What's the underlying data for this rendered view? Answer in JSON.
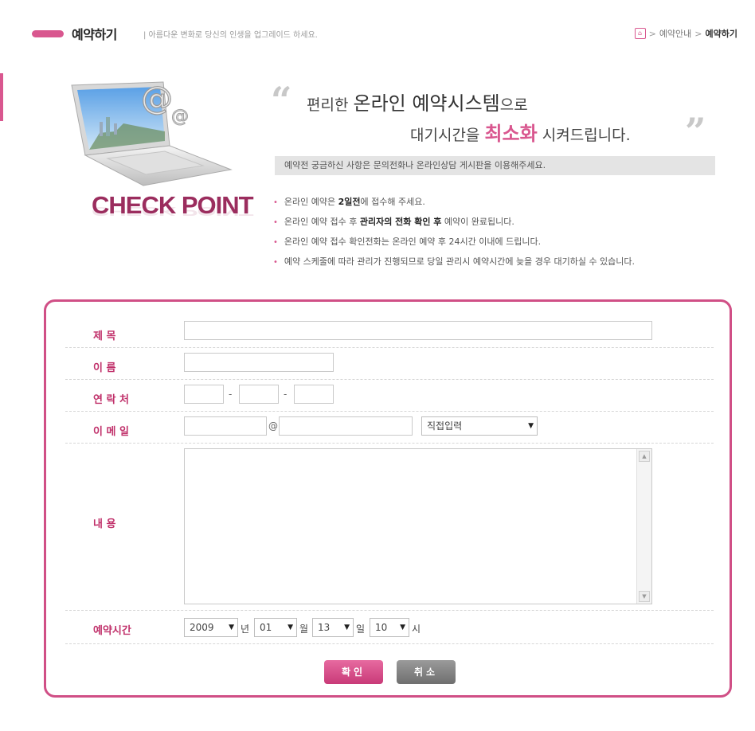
{
  "header": {
    "title": "예약하기",
    "subtitle": "| 아름다운 변화로 당신의 인생을 업그레이드 하세요.",
    "breadcrumb": {
      "home_icon": "home-icon",
      "parent": "예약안내",
      "current": "예약하기",
      "separator": ">"
    }
  },
  "intro": {
    "check_point": "CHECK POINT",
    "slogan_line1_a": "편리한 ",
    "slogan_line1_b": "온라인 예약시스템",
    "slogan_line1_c": "으로",
    "slogan_line2_a": "대기시간을 ",
    "slogan_line2_b": "최소화",
    "slogan_line2_c": " 시켜드립니다.",
    "notice": "예약전 궁금하신 사항은 문의전화나 온라인상담 게시판을 이용해주세요.",
    "bullets": [
      {
        "pre": "온라인 예약은 ",
        "bold": "2일전",
        "post": "에 접수해 주세요."
      },
      {
        "pre": "온라인 예약 접수 후 ",
        "bold": "관리자의 전화 확인 후",
        "post": " 예약이 완료됩니다."
      },
      {
        "pre": "온라인 예약 접수 확인전화는 온라인 예약 후 24시간 이내에 드립니다.",
        "bold": "",
        "post": ""
      },
      {
        "pre": "예약 스케줄에 따라 관리가 진행되므로 당일 관리시 예약시간에 늦을 경우 대기하실 수 있습니다.",
        "bold": "",
        "post": ""
      }
    ]
  },
  "form": {
    "labels": {
      "title": "제    목",
      "name": "이    름",
      "phone": "연 락 처",
      "email": "이 메 일",
      "content": "내    용",
      "time": "예약시간"
    },
    "fields": {
      "title_value": "",
      "name_value": "",
      "phone1": "",
      "phone2": "",
      "phone3": "",
      "email_id": "",
      "email_domain": "",
      "email_select": "직접입력",
      "content_value": ""
    },
    "phone_dash": "-",
    "email_at": "@",
    "time": {
      "year": "2009",
      "year_unit": "년",
      "month": "01",
      "month_unit": "월",
      "day": "13",
      "day_unit": "일",
      "hour": "10",
      "hour_unit": "시"
    },
    "buttons": {
      "ok": "확인",
      "cancel": "취소"
    }
  },
  "colors": {
    "accent": "#d9578f",
    "border": "#d04f86",
    "label": "#c0306a",
    "check_point": "#9b2d5e"
  }
}
